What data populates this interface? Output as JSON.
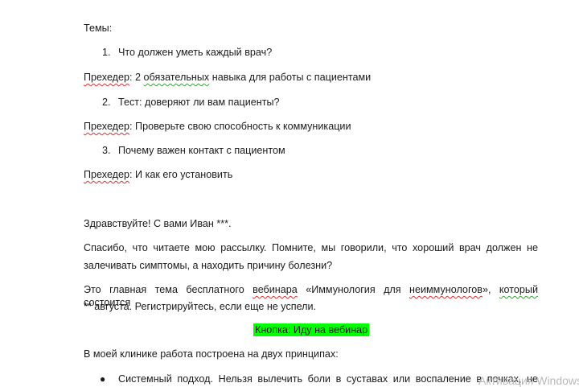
{
  "doc": {
    "topics_label": "Темы:",
    "items": [
      {
        "num": "1.",
        "text": "Что должен уметь каждый врач?",
        "preheader_label": "Прехедер",
        "preheader_pre": ": 2 ",
        "preheader_gram": "обязательных",
        "preheader_rest": " навыка для работы с пациентами"
      },
      {
        "num": "2.",
        "text": "Тест: доверяют ли вам пациенты?",
        "preheader_label": "Прехедер",
        "preheader_rest": ": Проверьте свою способность к коммуникации"
      },
      {
        "num": "3.",
        "text": "Почему важен контакт с пациентом",
        "preheader_label": "Прехедер",
        "preheader_rest": ": И как его установить"
      }
    ],
    "greeting": "Здравствуйте! С вами Иван ***.",
    "para1_line1": "Спасибо, что читаете мою рассылку. Помните, мы говорили, что хороший врач должен не",
    "para1_line2": "залечивать симптомы, а находить причину болезни?",
    "para2_a": "Это главная тема бесплатного ",
    "para2_b": "вебинара",
    "para2_c": " «Иммунология для ",
    "para2_d": "неиммунологов",
    "para2_e": "», ",
    "para2_f": "который",
    "para2_g": " состоится",
    "para2_line2": "** августа. Регистрируйтесь, если еще не успели.",
    "button_label": "Кнопка: Иду на вебинар",
    "para3": "В моей клинике работа построена на двух принципах:",
    "bullet1": "Системный подход. Нельзя вылечить боли в суставах или воспаление в почках, не",
    "watermark": "Активация Windows"
  }
}
